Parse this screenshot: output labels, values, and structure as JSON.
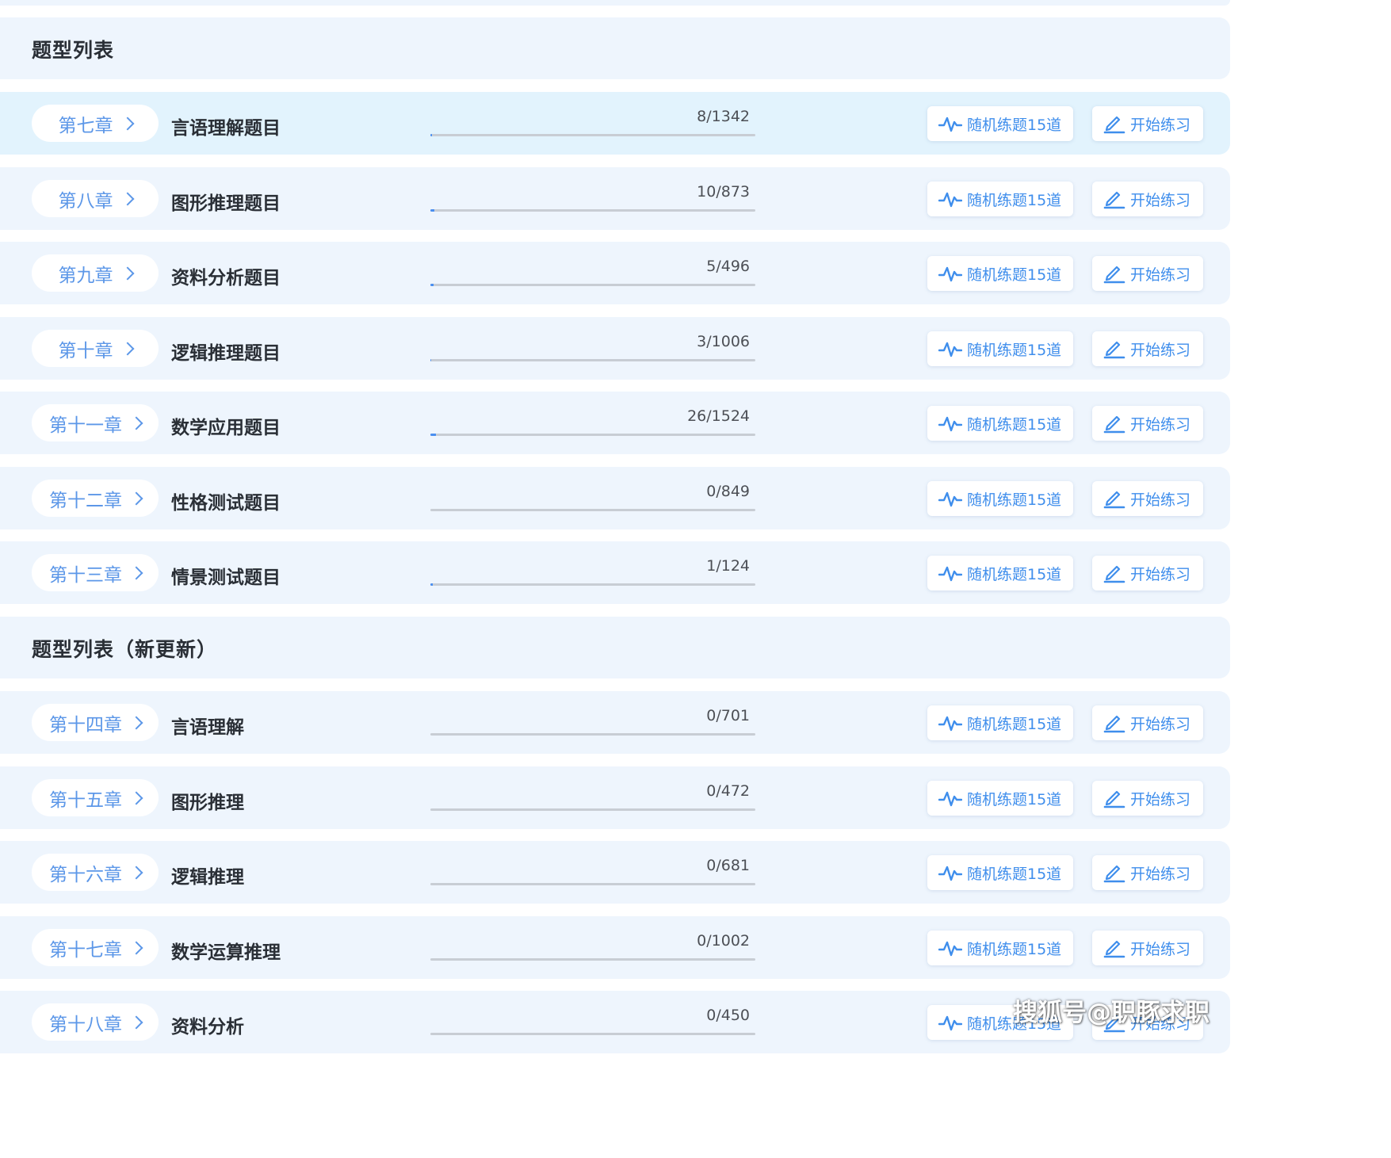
{
  "sections": [
    {
      "title": "题型列表"
    },
    {
      "title": "题型列表（新更新）"
    }
  ],
  "rows": [
    {
      "chapter": "第七章",
      "title": "言语理解题目",
      "count": "8/1342",
      "done": 8,
      "total": 1342,
      "random_label": "随机练题15道",
      "start_label": "开始练习"
    },
    {
      "chapter": "第八章",
      "title": "图形推理题目",
      "count": "10/873",
      "done": 10,
      "total": 873,
      "random_label": "随机练题15道",
      "start_label": "开始练习"
    },
    {
      "chapter": "第九章",
      "title": "资料分析题目",
      "count": "5/496",
      "done": 5,
      "total": 496,
      "random_label": "随机练题15道",
      "start_label": "开始练习"
    },
    {
      "chapter": "第十章",
      "title": "逻辑推理题目",
      "count": "3/1006",
      "done": 3,
      "total": 1006,
      "random_label": "随机练题15道",
      "start_label": "开始练习"
    },
    {
      "chapter": "第十一章",
      "title": "数学应用题目",
      "count": "26/1524",
      "done": 26,
      "total": 1524,
      "random_label": "随机练题15道",
      "start_label": "开始练习"
    },
    {
      "chapter": "第十二章",
      "title": "性格测试题目",
      "count": "0/849",
      "done": 0,
      "total": 849,
      "random_label": "随机练题15道",
      "start_label": "开始练习"
    },
    {
      "chapter": "第十三章",
      "title": "情景测试题目",
      "count": "1/124",
      "done": 1,
      "total": 124,
      "random_label": "随机练题15道",
      "start_label": "开始练习"
    },
    {
      "chapter": "第十四章",
      "title": "言语理解",
      "count": "0/701",
      "done": 0,
      "total": 701,
      "random_label": "随机练题15道",
      "start_label": "开始练习"
    },
    {
      "chapter": "第十五章",
      "title": "图形推理",
      "count": "0/472",
      "done": 0,
      "total": 472,
      "random_label": "随机练题15道",
      "start_label": "开始练习"
    },
    {
      "chapter": "第十六章",
      "title": "逻辑推理",
      "count": "0/681",
      "done": 0,
      "total": 681,
      "random_label": "随机练题15道",
      "start_label": "开始练习"
    },
    {
      "chapter": "第十七章",
      "title": "数学运算推理",
      "count": "0/1002",
      "done": 0,
      "total": 1002,
      "random_label": "随机练题15道",
      "start_label": "开始练习"
    },
    {
      "chapter": "第十八章",
      "title": "资料分析",
      "count": "0/450",
      "done": 0,
      "total": 450,
      "random_label": "随机练题15道",
      "start_label": "开始练习"
    }
  ],
  "watermark": "搜狐号@职豚求职",
  "colors": {
    "accent": "#3f8eec",
    "chapter_text": "#5c97e8",
    "row_bg": "#eef5fd",
    "row_highlight": "#e2f3fd"
  }
}
